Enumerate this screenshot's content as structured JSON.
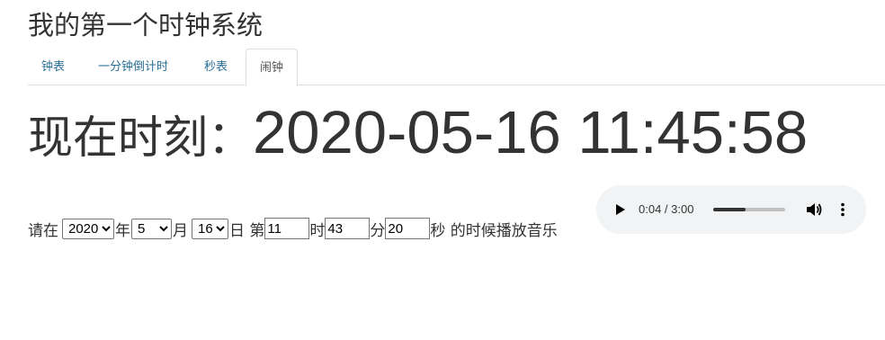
{
  "page_title": "我的第一个时钟系统",
  "tabs": [
    {
      "label": "钟表",
      "active": false
    },
    {
      "label": "一分钟倒计时",
      "active": false
    },
    {
      "label": "秒表",
      "active": false
    },
    {
      "label": "闹钟",
      "active": true
    }
  ],
  "clock": {
    "label": "现在时刻：",
    "time": "2020-05-16 11:45:58"
  },
  "alarm": {
    "prefix": "请在",
    "year": {
      "selected": "2020",
      "options": [
        "2020"
      ]
    },
    "year_label": "年",
    "month": {
      "selected": "5",
      "options": [
        "5"
      ]
    },
    "month_label": "月",
    "day": {
      "selected": "16",
      "options": [
        "16"
      ]
    },
    "day_label": "日 第",
    "hour_value": "11",
    "hour_label": "时",
    "minute_value": "43",
    "minute_label": "分",
    "second_value": "20",
    "suffix": "秒 的时候播放音乐"
  },
  "audio_player": {
    "time_display": "0:04 / 3:00",
    "progress_fraction": 0.45,
    "icons": [
      "play-icon",
      "volume-icon",
      "more-vert-icon"
    ]
  },
  "colors": {
    "tab_link": "#2a6f97",
    "text": "#333333",
    "player_bg": "#f1f3f4"
  }
}
